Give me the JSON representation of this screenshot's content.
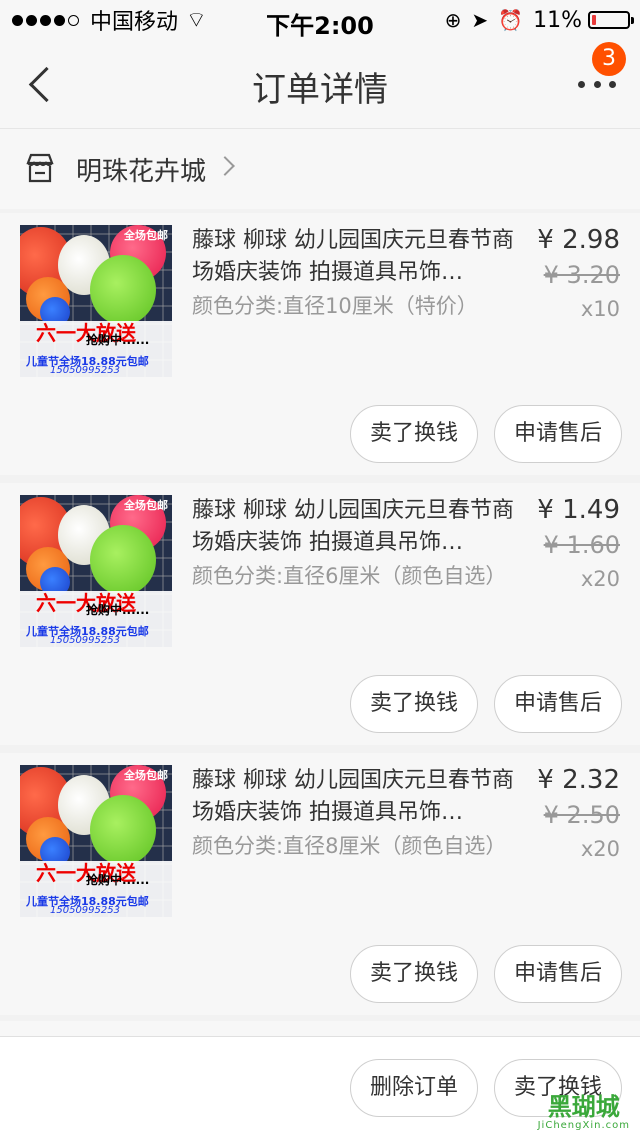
{
  "status_bar": {
    "carrier": "中国移动",
    "time": "下午2:00",
    "battery": "11%",
    "battery_level": 0.11,
    "battery_color": "#e83b3b"
  },
  "nav": {
    "title": "订单详情",
    "badge": "3",
    "badge_color": "#ff5000"
  },
  "shop": {
    "name": "明珠花卉城"
  },
  "thumbnail": {
    "banner": "全场包邮",
    "headline": "六一大放送",
    "sub": "抢购中......",
    "promo": "儿童节全场18.88元包邮",
    "phone": "15050995253"
  },
  "items": [
    {
      "title": "藤球 柳球 幼儿园国庆元旦春节商场婚庆装饰 拍摄道具吊饰…",
      "variant": "颜色分类:直径10厘米（特价）",
      "price": "¥ 2.98",
      "original_price": "¥ 3.20",
      "quantity": "x10",
      "sell_label": "卖了换钱",
      "after_sale_label": "申请售后"
    },
    {
      "title": "藤球 柳球 幼儿园国庆元旦春节商场婚庆装饰 拍摄道具吊饰…",
      "variant": "颜色分类:直径6厘米（颜色自选）",
      "price": "¥ 1.49",
      "original_price": "¥ 1.60",
      "quantity": "x20",
      "sell_label": "卖了换钱",
      "after_sale_label": "申请售后"
    },
    {
      "title": "藤球 柳球 幼儿园国庆元旦春节商场婚庆装饰 拍摄道具吊饰…",
      "variant": "颜色分类:直径8厘米（颜色自选）",
      "price": "¥ 2.32",
      "original_price": "¥ 2.50",
      "quantity": "x20",
      "sell_label": "卖了换钱",
      "after_sale_label": "申请售后"
    }
  ],
  "bottom_bar": {
    "delete_label": "删除订单",
    "sell_label": "卖了换钱"
  },
  "watermark": {
    "main": "黑瑚城",
    "sub": "JiChengXin.com"
  }
}
